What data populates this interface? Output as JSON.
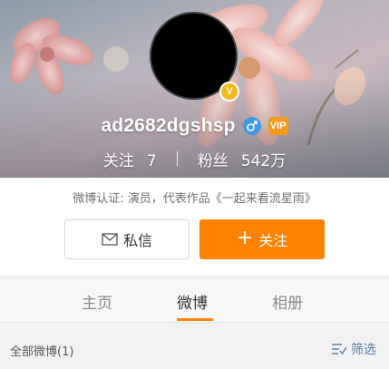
{
  "profile": {
    "username": "ad2682dgshsp",
    "verified_badge": "V",
    "vip_badge": "VIP",
    "gender_icon": "male-icon",
    "following_label": "关注",
    "following_count": "7",
    "followers_label": "粉丝",
    "followers_count": "542万",
    "certification": "微博认证: 演员，代表作品《一起来看流星雨》"
  },
  "actions": {
    "message_label": "私信",
    "message_icon": "mail-icon",
    "follow_label": "关注",
    "follow_icon": "plus-icon"
  },
  "tabs": [
    {
      "label": "主页",
      "active": false
    },
    {
      "label": "微博",
      "active": true
    },
    {
      "label": "相册",
      "active": false
    }
  ],
  "filter_bar": {
    "count_text": "全部微博(1)",
    "filter_label": "筛选",
    "filter_icon": "filter-icon"
  },
  "colors": {
    "accent": "#ff8200",
    "verified": "#f3b91a",
    "gender": "#3d9be9",
    "link": "#5d7ea3"
  }
}
